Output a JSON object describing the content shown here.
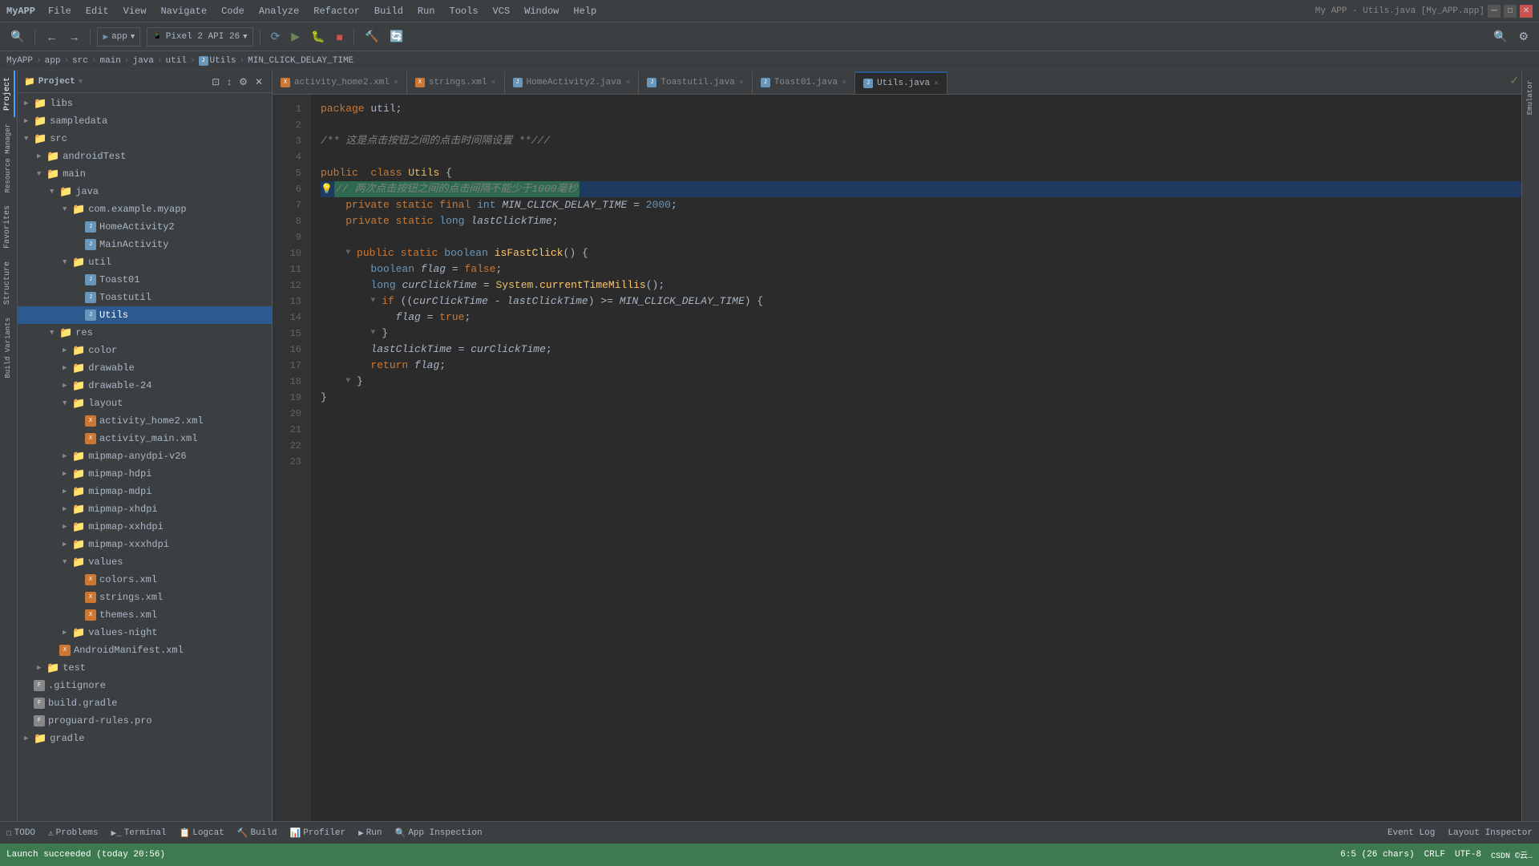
{
  "window": {
    "title": "My APP - Utils.java [My_APP.app]"
  },
  "menubar": {
    "appname": "MyAPP",
    "items": [
      "File",
      "Edit",
      "View",
      "Navigate",
      "Code",
      "Analyze",
      "Refactor",
      "Build",
      "Run",
      "Tools",
      "VCS",
      "Window",
      "Help"
    ]
  },
  "breadcrumb": {
    "items": [
      "MyAPP",
      "app",
      "src",
      "main",
      "java",
      "util",
      "Utils",
      "MIN_CLICK_DELAY_TIME"
    ]
  },
  "tabs": [
    {
      "label": "activity_home2.xml",
      "type": "xml",
      "active": false
    },
    {
      "label": "strings.xml",
      "type": "xml",
      "active": false
    },
    {
      "label": "HomeActivity2.java",
      "type": "java",
      "active": false
    },
    {
      "label": "Toastutil.java",
      "type": "java",
      "active": false
    },
    {
      "label": "Toast01.java",
      "type": "java",
      "active": false
    },
    {
      "label": "Utils.java",
      "type": "java",
      "active": true
    }
  ],
  "project_panel": {
    "title": "Project",
    "tree": [
      {
        "indent": 0,
        "label": "libs",
        "type": "folder",
        "expanded": false
      },
      {
        "indent": 0,
        "label": "sampledata",
        "type": "folder",
        "expanded": false
      },
      {
        "indent": 0,
        "label": "src",
        "type": "folder",
        "expanded": true
      },
      {
        "indent": 1,
        "label": "androidTest",
        "type": "folder",
        "expanded": false
      },
      {
        "indent": 1,
        "label": "main",
        "type": "folder",
        "expanded": true
      },
      {
        "indent": 2,
        "label": "java",
        "type": "folder",
        "expanded": true
      },
      {
        "indent": 3,
        "label": "com.example.myapp",
        "type": "folder",
        "expanded": true
      },
      {
        "indent": 4,
        "label": "HomeActivity2",
        "type": "java",
        "expanded": false
      },
      {
        "indent": 4,
        "label": "MainActivity",
        "type": "java",
        "expanded": false
      },
      {
        "indent": 3,
        "label": "util",
        "type": "folder",
        "expanded": true
      },
      {
        "indent": 4,
        "label": "Toast01",
        "type": "java",
        "expanded": false
      },
      {
        "indent": 4,
        "label": "Toastutil",
        "type": "java",
        "expanded": false
      },
      {
        "indent": 4,
        "label": "Utils",
        "type": "java",
        "expanded": false,
        "selected": true
      },
      {
        "indent": 2,
        "label": "res",
        "type": "folder",
        "expanded": true
      },
      {
        "indent": 3,
        "label": "color",
        "type": "folder",
        "expanded": false
      },
      {
        "indent": 3,
        "label": "drawable",
        "type": "folder",
        "expanded": false
      },
      {
        "indent": 3,
        "label": "drawable-24",
        "type": "folder",
        "expanded": false
      },
      {
        "indent": 3,
        "label": "layout",
        "type": "folder",
        "expanded": true
      },
      {
        "indent": 4,
        "label": "activity_home2.xml",
        "type": "xml",
        "expanded": false
      },
      {
        "indent": 4,
        "label": "activity_main.xml",
        "type": "xml",
        "expanded": false
      },
      {
        "indent": 3,
        "label": "mipmap-anydpi-v26",
        "type": "folder",
        "expanded": false
      },
      {
        "indent": 3,
        "label": "mipmap-hdpi",
        "type": "folder",
        "expanded": false
      },
      {
        "indent": 3,
        "label": "mipmap-mdpi",
        "type": "folder",
        "expanded": false
      },
      {
        "indent": 3,
        "label": "mipmap-xhdpi",
        "type": "folder",
        "expanded": false
      },
      {
        "indent": 3,
        "label": "mipmap-xxhdpi",
        "type": "folder",
        "expanded": false
      },
      {
        "indent": 3,
        "label": "mipmap-xxxhdpi",
        "type": "folder",
        "expanded": false
      },
      {
        "indent": 3,
        "label": "values",
        "type": "folder",
        "expanded": true
      },
      {
        "indent": 4,
        "label": "colors.xml",
        "type": "xml",
        "expanded": false
      },
      {
        "indent": 4,
        "label": "strings.xml",
        "type": "xml",
        "expanded": false
      },
      {
        "indent": 4,
        "label": "themes.xml",
        "type": "xml",
        "expanded": false
      },
      {
        "indent": 3,
        "label": "values-night",
        "type": "folder",
        "expanded": false
      },
      {
        "indent": 2,
        "label": "AndroidManifest.xml",
        "type": "xml",
        "expanded": false
      },
      {
        "indent": 1,
        "label": "test",
        "type": "folder",
        "expanded": false
      },
      {
        "indent": 0,
        "label": ".gitignore",
        "type": "file",
        "expanded": false
      },
      {
        "indent": 0,
        "label": "build.gradle",
        "type": "file",
        "expanded": false
      },
      {
        "indent": 0,
        "label": "proguard-rules.pro",
        "type": "file",
        "expanded": false
      },
      {
        "indent": 0,
        "label": "gradle",
        "type": "folder",
        "expanded": false
      }
    ]
  },
  "code": {
    "lines": [
      {
        "num": 1,
        "text": "package util;"
      },
      {
        "num": 2,
        "text": ""
      },
      {
        "num": 3,
        "text": "/** 这是点击按钮之间的点击时间隔设置 **//",
        "type": "comment"
      },
      {
        "num": 4,
        "text": ""
      },
      {
        "num": 5,
        "text": "public  class Utils {"
      },
      {
        "num": 6,
        "text": "    // 两次点击按钮之间的点击间隔不能少于1000毫秒",
        "type": "comment",
        "highlighted": true,
        "hasBulb": true,
        "foldable": false
      },
      {
        "num": 7,
        "text": "    private static final int MIN_CLICK_DELAY_TIME = 2000;"
      },
      {
        "num": 8,
        "text": "    private static long lastClickTime;"
      },
      {
        "num": 9,
        "text": ""
      },
      {
        "num": 10,
        "text": "    public static boolean isFastClick() {",
        "foldable": true
      },
      {
        "num": 11,
        "text": "        boolean flag = false;"
      },
      {
        "num": 12,
        "text": "        long curClickTime = System.currentTimeMillis();"
      },
      {
        "num": 13,
        "text": "        if ((curClickTime - lastClickTime) >= MIN_CLICK_DELAY_TIME) {",
        "foldable": true
      },
      {
        "num": 14,
        "text": "            flag = true;"
      },
      {
        "num": 15,
        "text": "        }",
        "foldable": true
      },
      {
        "num": 16,
        "text": "        lastClickTime = curClickTime;"
      },
      {
        "num": 17,
        "text": "        return flag;"
      },
      {
        "num": 18,
        "text": "    }",
        "foldable": true
      },
      {
        "num": 19,
        "text": "}"
      },
      {
        "num": 20,
        "text": ""
      },
      {
        "num": 21,
        "text": ""
      },
      {
        "num": 22,
        "text": ""
      },
      {
        "num": 23,
        "text": ""
      }
    ]
  },
  "statusbar": {
    "message": "Launch succeeded (today 20:56)",
    "position": "6:5 (26 chars)",
    "encoding": "CRLF",
    "indent": "UTF-8"
  },
  "bottombar": {
    "items": [
      "TODO",
      "Problems",
      "Terminal",
      "Logcat",
      "Build",
      "Profiler",
      "Run",
      "App Inspection"
    ],
    "right_items": [
      "Event Log",
      "Layout Inspector"
    ]
  },
  "toolbar": {
    "app_selector": "app",
    "device_selector": "Pixel 2 API 26"
  },
  "vertical_tabs": {
    "left": [
      "Project",
      "Structure",
      "Favorites",
      "Build Variants"
    ],
    "right": [
      "Emulator"
    ]
  }
}
